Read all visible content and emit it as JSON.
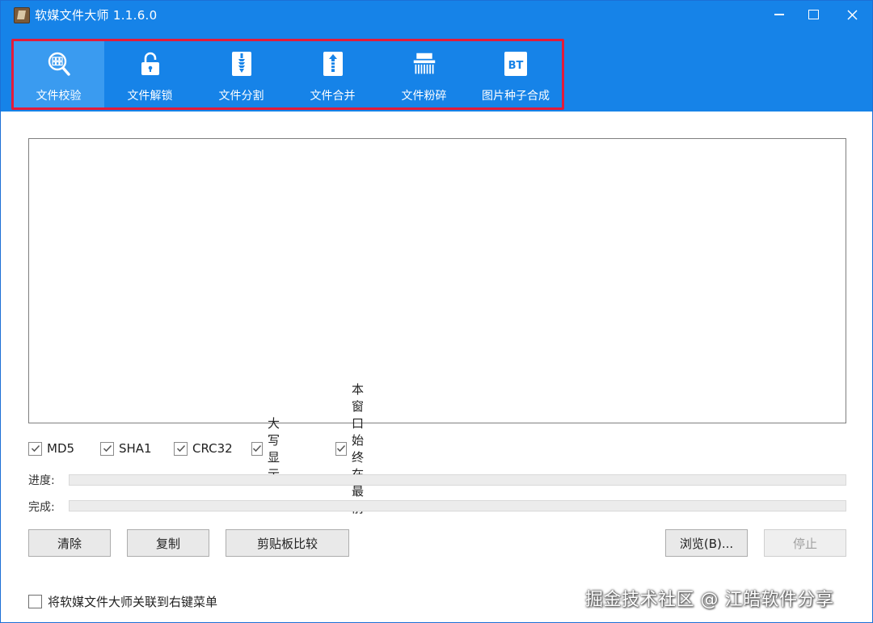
{
  "window": {
    "title": "软媒文件大师 1.1.6.0",
    "minimize_label": "",
    "maximize_label": "",
    "close_label": ""
  },
  "toolbar": {
    "items": [
      {
        "label": "文件校验",
        "icon": "file-verify-icon",
        "active": true
      },
      {
        "label": "文件解锁",
        "icon": "unlock-icon",
        "active": false
      },
      {
        "label": "文件分割",
        "icon": "file-split-icon",
        "active": false
      },
      {
        "label": "文件合并",
        "icon": "file-merge-icon",
        "active": false
      },
      {
        "label": "文件粉碎",
        "icon": "shredder-icon",
        "active": false
      },
      {
        "label": "图片种子合成",
        "icon": "bt-icon",
        "active": false
      }
    ],
    "bt_icon_text": "BT",
    "highlight_color": "#e31b3a",
    "header_color": "#1683e8"
  },
  "options": {
    "md5": {
      "label": "MD5",
      "checked": true
    },
    "sha1": {
      "label": "SHA1",
      "checked": true
    },
    "crc32": {
      "label": "CRC32",
      "checked": true
    },
    "uppercase": {
      "label": "大写显示",
      "checked": true
    },
    "topmost": {
      "label": "本窗口始终在最前",
      "checked": true
    }
  },
  "progress": {
    "progress_label": "进度:",
    "progress_value": 0,
    "complete_label": "完成:",
    "complete_value": 0
  },
  "buttons": {
    "clear": "清除",
    "copy": "复制",
    "clipboard_compare": "剪贴板比较",
    "browse": "浏览(B)...",
    "stop": "停止"
  },
  "footer": {
    "context_menu_label": "将软媒文件大师关联到右键菜单",
    "context_menu_checked": false,
    "watermark": "掘金技术社区 @ 江皓软件分享"
  }
}
